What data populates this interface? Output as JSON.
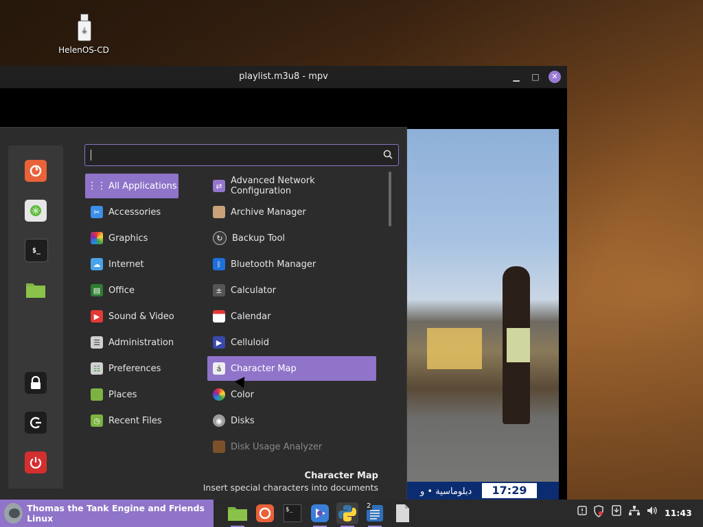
{
  "desktop": {
    "icons": [
      {
        "label": "HelenOS-CD",
        "icon": "usb-drive-icon"
      }
    ]
  },
  "window": {
    "title": "playlist.m3u8 - mpv",
    "video": {
      "overlay_text_ar": "دبلوماسية • و",
      "overlay_time": "17:29"
    }
  },
  "menu": {
    "search": {
      "value": "",
      "placeholder": ""
    },
    "favorites": [
      {
        "name": "firefox-icon"
      },
      {
        "name": "network-manager-icon"
      },
      {
        "name": "terminal-icon"
      },
      {
        "name": "files-icon"
      },
      {
        "name": "lock-screen-icon"
      },
      {
        "name": "logout-icon"
      },
      {
        "name": "power-icon"
      }
    ],
    "categories": [
      {
        "label": "All Applications",
        "icon": "grid-icon",
        "active": true
      },
      {
        "label": "Accessories",
        "icon": "accessories-icon"
      },
      {
        "label": "Graphics",
        "icon": "graphics-icon"
      },
      {
        "label": "Internet",
        "icon": "internet-icon"
      },
      {
        "label": "Office",
        "icon": "office-icon"
      },
      {
        "label": "Sound & Video",
        "icon": "sound-video-icon"
      },
      {
        "label": "Administration",
        "icon": "administration-icon"
      },
      {
        "label": "Preferences",
        "icon": "preferences-icon"
      },
      {
        "label": "Places",
        "icon": "places-icon"
      },
      {
        "label": "Recent Files",
        "icon": "recent-files-icon"
      }
    ],
    "apps": [
      {
        "label": "Advanced Network Configuration",
        "icon": "network-config-icon"
      },
      {
        "label": "Archive Manager",
        "icon": "archive-icon"
      },
      {
        "label": "Backup Tool",
        "icon": "backup-icon"
      },
      {
        "label": "Bluetooth Manager",
        "icon": "bluetooth-icon"
      },
      {
        "label": "Calculator",
        "icon": "calculator-icon"
      },
      {
        "label": "Calendar",
        "icon": "calendar-icon"
      },
      {
        "label": "Celluloid",
        "icon": "celluloid-icon"
      },
      {
        "label": "Character Map",
        "icon": "character-map-icon",
        "active": true
      },
      {
        "label": "Color",
        "icon": "color-icon"
      },
      {
        "label": "Disks",
        "icon": "disks-icon"
      },
      {
        "label": "Disk Usage Analyzer",
        "icon": "disk-usage-icon",
        "dim": true
      }
    ],
    "description": {
      "title": "Character Map",
      "text": "Insert special characters into documents"
    }
  },
  "taskbar": {
    "menu_label": "Thomas the Tank Engine and Friends Linux",
    "apps": [
      {
        "name": "files-icon"
      },
      {
        "name": "firefox-icon"
      },
      {
        "name": "terminal-icon"
      },
      {
        "name": "mpv-icon"
      },
      {
        "name": "python-icon",
        "active": true
      },
      {
        "name": "text-editor-icon",
        "badge": "2"
      },
      {
        "name": "document-icon"
      }
    ],
    "tray": [
      "notifications-icon",
      "shield-icon",
      "update-manager-icon",
      "network-icon",
      "volume-icon"
    ],
    "clock": "11:43"
  },
  "colors": {
    "accent": "#8f74c9",
    "panel": "#2c2c2c",
    "taskbar": "#2a2a2a"
  }
}
